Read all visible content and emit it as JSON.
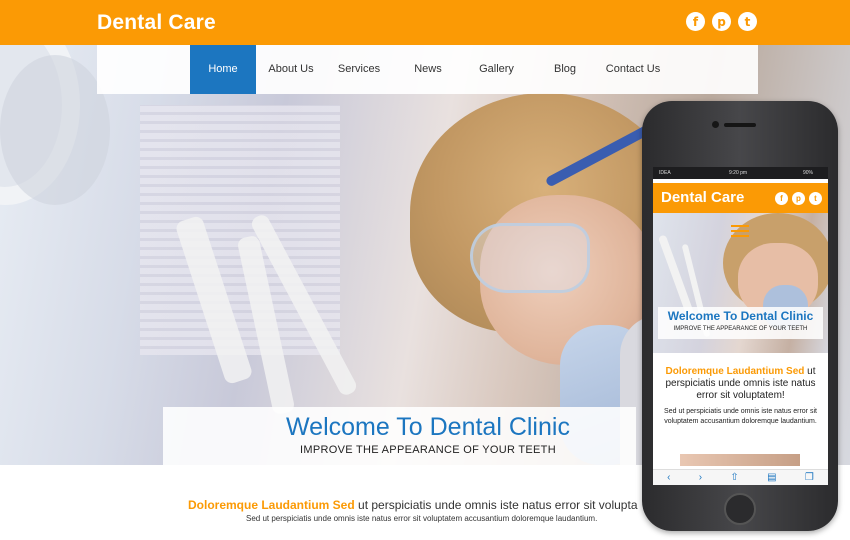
{
  "header": {
    "brand": "Dental Care",
    "social": [
      {
        "icon": "facebook-icon",
        "glyph": "f"
      },
      {
        "icon": "pinterest-icon",
        "glyph": "p"
      },
      {
        "icon": "twitter-icon",
        "glyph": "t"
      }
    ]
  },
  "nav": {
    "items": [
      {
        "label": "Home",
        "active": true
      },
      {
        "label": "About Us",
        "active": false
      },
      {
        "label": "Services",
        "active": false
      },
      {
        "label": "News",
        "active": false
      },
      {
        "label": "Gallery",
        "active": false
      },
      {
        "label": "Blog",
        "active": false
      },
      {
        "label": "Contact Us",
        "active": false
      }
    ]
  },
  "hero": {
    "title": "Welcome To Dental Clinic",
    "subtitle": "IMPROVE THE APPEARANCE OF YOUR TEETH"
  },
  "intro": {
    "highlight": "Doloremque Laudantium Sed",
    "rest": " ut perspiciatis unde omnis iste natus error sit volupta",
    "sub": "Sed ut perspiciatis unde omnis iste natus error sit voluptatem accusantium doloremque laudantium."
  },
  "mobile": {
    "status_carrier": "IDEA",
    "status_time": "9:20 pm",
    "status_battery": "90%",
    "brand": "Dental Care",
    "welcome_title": "Welcome To Dental Clinic",
    "welcome_subtitle": "IMPROVE THE APPEARANCE OF YOUR TEETH",
    "intro_highlight": "Doloremque Laudantium Sed",
    "intro_rest": " ut perspiciatis unde omnis iste natus error sit voluptatem!",
    "sub": "Sed ut perspiciatis unde omnis iste natus error sit voluptatem accusantium doloremque laudantium."
  },
  "colors": {
    "accent_orange": "#fb9a05",
    "accent_blue": "#1c76c0"
  }
}
